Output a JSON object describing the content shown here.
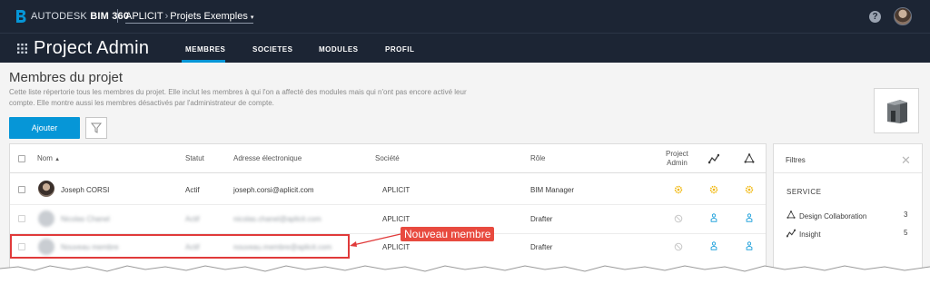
{
  "header": {
    "brand_prefix": "AUTODESK",
    "brand_product": "BIM 360",
    "account": "APLICIT",
    "project": "Projets Exemples",
    "help_icon": "question-circle-icon",
    "help_glyph": "?"
  },
  "nav": {
    "app_title": "Project Admin",
    "tabs": [
      {
        "label": "MEMBRES",
        "active": true
      },
      {
        "label": "SOCIETES",
        "active": false
      },
      {
        "label": "MODULES",
        "active": false
      },
      {
        "label": "PROFIL",
        "active": false
      }
    ]
  },
  "page": {
    "title": "Membres du projet",
    "description": "Cette liste répertorie tous les membres du projet. Elle inclut les membres à qui l'on a affecté des modules mais qui n'ont pas encore activé leur compte. Elle montre aussi les membres désactivés par l'administrateur de compte.",
    "add_button": "Ajouter"
  },
  "table": {
    "columns": {
      "name": "Nom",
      "status": "Statut",
      "email": "Adresse électronique",
      "company": "Société",
      "role": "Rôle",
      "project_admin_line1": "Project",
      "project_admin_line2": "Admin"
    },
    "rows": [
      {
        "name": "Joseph CORSI",
        "status": "Actif",
        "email": "joseph.corsi@aplicit.com",
        "company": "APLICIT",
        "role": "BIM Manager"
      },
      {
        "name": "Nicolas Chanel",
        "status": "Actif",
        "email": "nicolas.chanel@aplicit.com",
        "company": "APLICIT",
        "role": "Drafter"
      },
      {
        "name": "Nouveau membre",
        "status": "Actif",
        "email": "nouveau.membre@aplicit.com",
        "company": "APLICIT",
        "role": "Drafter"
      }
    ]
  },
  "filters": {
    "title": "Filtres",
    "close_glyph": "✕",
    "service_heading": "SERVICE",
    "services": [
      {
        "label": "Design Collaboration",
        "count": "3"
      },
      {
        "label": "Insight",
        "count": "5"
      }
    ]
  },
  "annotation": {
    "label": "Nouveau membre"
  },
  "colors": {
    "header_bg": "#1c2534",
    "accent": "#0696d7",
    "gear": "#f0b400",
    "annotation_red": "#e03a3a"
  }
}
